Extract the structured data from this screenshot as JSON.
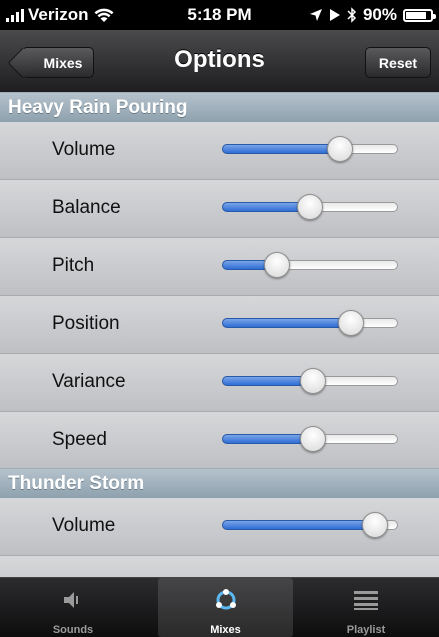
{
  "status_bar": {
    "carrier": "Verizon",
    "time": "5:18 PM",
    "battery": "90%",
    "battery_level": 0.9
  },
  "nav": {
    "back_label": "Mixes",
    "title": "Options",
    "reset_label": "Reset"
  },
  "sections": [
    {
      "title": "Heavy Rain Pouring",
      "rows": [
        {
          "label": "Volume",
          "value": 0.7
        },
        {
          "label": "Balance",
          "value": 0.5
        },
        {
          "label": "Pitch",
          "value": 0.28
        },
        {
          "label": "Position",
          "value": 0.77
        },
        {
          "label": "Variance",
          "value": 0.52
        },
        {
          "label": "Speed",
          "value": 0.52
        }
      ]
    },
    {
      "title": "Thunder Storm",
      "rows": [
        {
          "label": "Volume",
          "value": 0.93
        }
      ]
    }
  ],
  "tabs": [
    {
      "label": "Sounds",
      "icon": "speaker-icon",
      "active": false
    },
    {
      "label": "Mixes",
      "icon": "mixes-icon",
      "active": true
    },
    {
      "label": "Playlist",
      "icon": "list-icon",
      "active": false
    }
  ],
  "colors": {
    "slider_fill": "#2f6ed6",
    "section_header": "#9fb0bc",
    "tabbar": "#1a1a1c"
  }
}
